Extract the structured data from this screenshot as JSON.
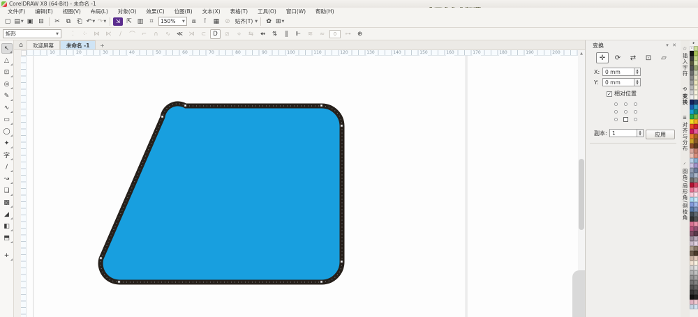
{
  "titlebar": {
    "title": "CorelDRAW X8 (64-Bit) - 未命名 -1",
    "watermark1_main": "会不会有人知",
    "watermark1_tail": "道",
    "watermark2": "我们有就减多成少"
  },
  "menubar": {
    "items": [
      {
        "name": "menu-file",
        "label": "文件(F)"
      },
      {
        "name": "menu-edit",
        "label": "编辑(E)"
      },
      {
        "name": "menu-view",
        "label": "视图(V)"
      },
      {
        "name": "menu-layout",
        "label": "布局(L)"
      },
      {
        "name": "menu-object",
        "label": "对象(O)"
      },
      {
        "name": "menu-effects",
        "label": "效果(C)"
      },
      {
        "name": "menu-bitmaps",
        "label": "位图(B)"
      },
      {
        "name": "menu-text",
        "label": "文本(X)"
      },
      {
        "name": "menu-table",
        "label": "表格(T)"
      },
      {
        "name": "menu-tools",
        "label": "工具(O)"
      },
      {
        "name": "menu-window",
        "label": "窗口(W)"
      },
      {
        "name": "menu-help",
        "label": "帮助(H)"
      }
    ]
  },
  "toolbar": {
    "zoom_level": "150%",
    "snap_label": "贴齐(T)",
    "buttons": [
      {
        "type": "btn",
        "name": "new-document-button",
        "glyph": "▢"
      },
      {
        "type": "btn",
        "name": "open-button",
        "glyph": "▤",
        "caret": true
      },
      {
        "type": "btn",
        "name": "save-button",
        "glyph": "▣"
      },
      {
        "type": "btn",
        "name": "print-button",
        "glyph": "⊟"
      },
      {
        "type": "sep"
      },
      {
        "type": "btn",
        "name": "cut-button",
        "glyph": "✂"
      },
      {
        "type": "btn",
        "name": "copy-button",
        "glyph": "⧉"
      },
      {
        "type": "btn",
        "name": "paste-button",
        "glyph": "⎗"
      },
      {
        "type": "btn",
        "name": "undo-button",
        "glyph": "↶",
        "caret": true
      },
      {
        "type": "btn",
        "name": "redo-button",
        "glyph": "↷",
        "caret": true,
        "disabled": true
      },
      {
        "type": "sep"
      },
      {
        "type": "btn",
        "name": "import-button",
        "glyph": "⇲",
        "accent": true
      },
      {
        "type": "btn",
        "name": "export-button",
        "glyph": "⇱"
      },
      {
        "type": "btn",
        "name": "publish-pdf-button",
        "glyph": "▥"
      },
      {
        "type": "btn",
        "name": "zoom-levels-button",
        "glyph": "⌗"
      },
      {
        "type": "zoomcombo"
      },
      {
        "type": "btn",
        "name": "fullscreen-preview-button",
        "glyph": "⧈"
      },
      {
        "type": "btn",
        "name": "show-rulers-button",
        "glyph": "⊺"
      },
      {
        "type": "btn",
        "name": "show-grid-button",
        "glyph": "▦"
      },
      {
        "type": "btn",
        "name": "snap-off-button",
        "glyph": "⊘",
        "disabled": true
      },
      {
        "type": "snaplabel"
      },
      {
        "type": "sep"
      },
      {
        "type": "btn",
        "name": "options-button",
        "glyph": "✿"
      },
      {
        "type": "btn",
        "name": "app-launcher-button",
        "glyph": "⊞",
        "caret": true
      }
    ]
  },
  "propbar": {
    "preset": "矩形",
    "smooth_value": "0",
    "icons": [
      {
        "name": "add-node-icon",
        "glyph": "⁚",
        "on": false
      },
      {
        "name": "delete-node-icon",
        "glyph": "⁘",
        "on": false
      },
      {
        "name": "join-nodes-icon",
        "glyph": "⋈",
        "on": false
      },
      {
        "name": "break-curve-icon",
        "glyph": "⋉",
        "on": false
      },
      {
        "name": "to-line-icon",
        "glyph": "∕",
        "on": false
      },
      {
        "name": "to-curve-icon",
        "glyph": "⌒",
        "on": false
      },
      {
        "name": "cusp-node-icon",
        "glyph": "⌐",
        "on": false
      },
      {
        "name": "smooth-node-icon",
        "glyph": "∩",
        "on": false
      },
      {
        "name": "symmetric-node-icon",
        "glyph": "∿",
        "on": false
      },
      {
        "name": "reverse-direction-icon",
        "glyph": "≪",
        "on": true
      },
      {
        "name": "extend-curve-icon",
        "glyph": "⋊",
        "on": false
      },
      {
        "name": "extract-subpath-icon",
        "glyph": "⊂",
        "on": false
      },
      {
        "name": "close-curve-icon",
        "glyph": "D",
        "on": true,
        "boxed": true
      },
      {
        "name": "stretch-nodes-icon",
        "glyph": "⧄",
        "on": false
      },
      {
        "name": "rotate-nodes-icon",
        "glyph": "⟡",
        "on": false
      },
      {
        "name": "align-nodes-icon",
        "glyph": "⇆",
        "on": false
      },
      {
        "name": "horizontal-reflect-icon",
        "glyph": "⇹",
        "on": true
      },
      {
        "name": "vertical-reflect-icon",
        "glyph": "⇅",
        "on": true
      },
      {
        "name": "elastic-mode-icon",
        "glyph": "‖",
        "on": true
      },
      {
        "name": "select-all-nodes-icon",
        "glyph": "⊩",
        "on": true
      },
      {
        "name": "reduce-nodes-icon",
        "glyph": "≋",
        "on": false
      },
      {
        "name": "curve-smoothness-icon",
        "glyph": "≈",
        "on": false
      }
    ],
    "end_icons": [
      {
        "name": "smooth-slider-icon",
        "glyph": "⊶",
        "on": false
      },
      {
        "name": "bounding-box-icon",
        "glyph": "⊕",
        "on": true
      }
    ]
  },
  "tabbar": {
    "home_icon": "⌂",
    "welcome_label": "欢迎屏幕",
    "doc_label": "未命名 -1",
    "new_tab_label": "+"
  },
  "toolbox": {
    "tools": [
      {
        "name": "pick-tool",
        "glyph": "↖",
        "active": true
      },
      {
        "name": "shape-tool",
        "glyph": "△"
      },
      {
        "name": "crop-tool",
        "glyph": "⊡"
      },
      {
        "name": "zoom-tool",
        "glyph": "◎"
      },
      {
        "name": "freehand-tool",
        "glyph": "✎"
      },
      {
        "name": "artistic-media-tool",
        "glyph": "∿"
      },
      {
        "name": "rectangle-tool",
        "glyph": "▭"
      },
      {
        "name": "ellipse-tool",
        "glyph": "◯"
      },
      {
        "name": "polygon-tool",
        "glyph": "✦"
      },
      {
        "name": "text-tool",
        "glyph": "字"
      },
      {
        "name": "parallel-dimension-tool",
        "glyph": "∕"
      },
      {
        "name": "connector-tool",
        "glyph": "↝"
      },
      {
        "name": "drop-shadow-tool",
        "glyph": "❏"
      },
      {
        "name": "transparency-tool",
        "glyph": "▩"
      },
      {
        "name": "color-eyedropper-tool",
        "glyph": "◢"
      },
      {
        "name": "interactive-fill-tool",
        "glyph": "◧"
      },
      {
        "name": "smart-fill-tool",
        "glyph": "⬒"
      },
      {
        "name": "customize-toolbox-button",
        "glyph": "+",
        "gap": true
      }
    ]
  },
  "ruler": {
    "h_numbers": [
      10,
      20,
      30,
      40,
      50,
      60,
      70,
      80,
      90,
      100,
      110,
      120,
      130,
      140,
      150,
      160,
      170,
      180,
      190,
      200
    ]
  },
  "canvas": {
    "shape_fill": "#189FDF",
    "shape_stroke": "#26201B"
  },
  "docker": {
    "title": "变换",
    "collapse_icon": "▾",
    "close_icon": "✕",
    "tabs": [
      {
        "name": "transform-position-tab",
        "glyph": "✛",
        "active": true
      },
      {
        "name": "transform-rotate-tab",
        "glyph": "⟳"
      },
      {
        "name": "transform-scale-mirror-tab",
        "glyph": "⇄"
      },
      {
        "name": "transform-size-tab",
        "glyph": "⊡"
      },
      {
        "name": "transform-skew-tab",
        "glyph": "▱"
      }
    ],
    "x_label": "X:",
    "x_value": "0 mm",
    "y_label": "Y:",
    "y_value": "0 mm",
    "relative_label": "相对位置",
    "relative_checked": "✓",
    "anchor_selected_index": 7,
    "copies_label": "副本:",
    "copies_value": "1",
    "apply_label": "应用"
  },
  "side_tabs": [
    {
      "name": "docker-tab-insert-character",
      "icon": "☆",
      "label": "插入字符"
    },
    {
      "name": "docker-tab-transform",
      "icon": "⟲",
      "label": "变换",
      "active": true
    },
    {
      "name": "docker-tab-align-distribute",
      "icon": "≣",
      "label": "对齐与分布"
    },
    {
      "name": "docker-tab-corners",
      "icon": "◜",
      "label": "圆角/扇形角/倒棱角"
    }
  ],
  "palette": {
    "fly_icon": "▸",
    "swatches": [
      [
        "none",
        "#cfe09d"
      ],
      [
        "#141414",
        "#a9c257"
      ],
      [
        "#3c3c3c",
        "#c3d487"
      ],
      [
        "#5a5a40",
        "#dbe5b0"
      ],
      [
        "#525252",
        "#97a370"
      ],
      [
        "#6f6f6f",
        "#cbcfb6"
      ],
      [
        "#878787",
        "#e2e0c4"
      ],
      [
        "#9d9d9d",
        "#ece6bf"
      ],
      [
        "#b5b5b5",
        "#f2edd0"
      ],
      [
        "#cfcfcf",
        "#f7f3de"
      ],
      [
        "#ececec",
        "#faf7e8"
      ],
      [
        "#17235c",
        "#25406e"
      ],
      [
        "#1e5fae",
        "#2f9cc3"
      ],
      [
        "#18a0d4",
        "#12897c"
      ],
      [
        "#23a94f",
        "#79b440"
      ],
      [
        "#f2df25",
        "#f2b01e"
      ],
      [
        "#e8491f",
        "#d31f2b"
      ],
      [
        "#c9195c",
        "#e55a9e"
      ],
      [
        "#e87a2e",
        "#b06020"
      ],
      [
        "#caa02a",
        "#8a5a28"
      ],
      [
        "#8c4c2a",
        "#5f3b20"
      ],
      [
        "#d9a89e",
        "#c47f6d"
      ],
      [
        "#e9c2b8",
        "#d88f7e"
      ],
      [
        "#bad0e8",
        "#8bb0d2"
      ],
      [
        "#c9c1e2",
        "#a393ca"
      ],
      [
        "#929cb2",
        "#6c7c9c"
      ],
      [
        "#8292aa",
        "#aab6ca"
      ],
      [
        "#6c6c6c",
        "#8c8c8c"
      ],
      [
        "#b21232",
        "#d24262"
      ],
      [
        "#e97292",
        "#f1a2ba"
      ],
      [
        "#f9cada",
        "#fce2ec"
      ],
      [
        "#aadaf2",
        "#cae9f9"
      ],
      [
        "#8299da",
        "#a2baea"
      ],
      [
        "#5a7aaa",
        "#7a92ba"
      ],
      [
        "#424a52",
        "#626a72"
      ],
      [
        "#323232",
        "#525252"
      ],
      [
        "#d97292",
        "#e992aa"
      ],
      [
        "#b2527a",
        "#925272"
      ],
      [
        "#7a4a62",
        "#5a3a4a"
      ],
      [
        "#9a8a9a",
        "#baaaba"
      ],
      [
        "#cabaca",
        "#e2d2e2"
      ],
      [
        "#aa9a8a",
        "#8a7a6a"
      ],
      [
        "#6a5a4a",
        "#4a3a2a"
      ],
      [
        "#cab2a2",
        "#e2caba"
      ],
      [
        "#f2e2d2",
        "#faf2e2"
      ],
      [
        "#d2d2d2",
        "#e2e2e2"
      ],
      [
        "#b2b2b2",
        "#c2c2c2"
      ],
      [
        "#929292",
        "#a2a2a2"
      ],
      [
        "#727272",
        "#828282"
      ],
      [
        "#525252",
        "#626262"
      ],
      [
        "#323232",
        "#424242"
      ],
      [
        "#121212",
        "#222222"
      ],
      [
        "#e2b2c2",
        "#f2cad2"
      ],
      [
        "#c2d2e2",
        "#d2e2f2"
      ]
    ]
  }
}
